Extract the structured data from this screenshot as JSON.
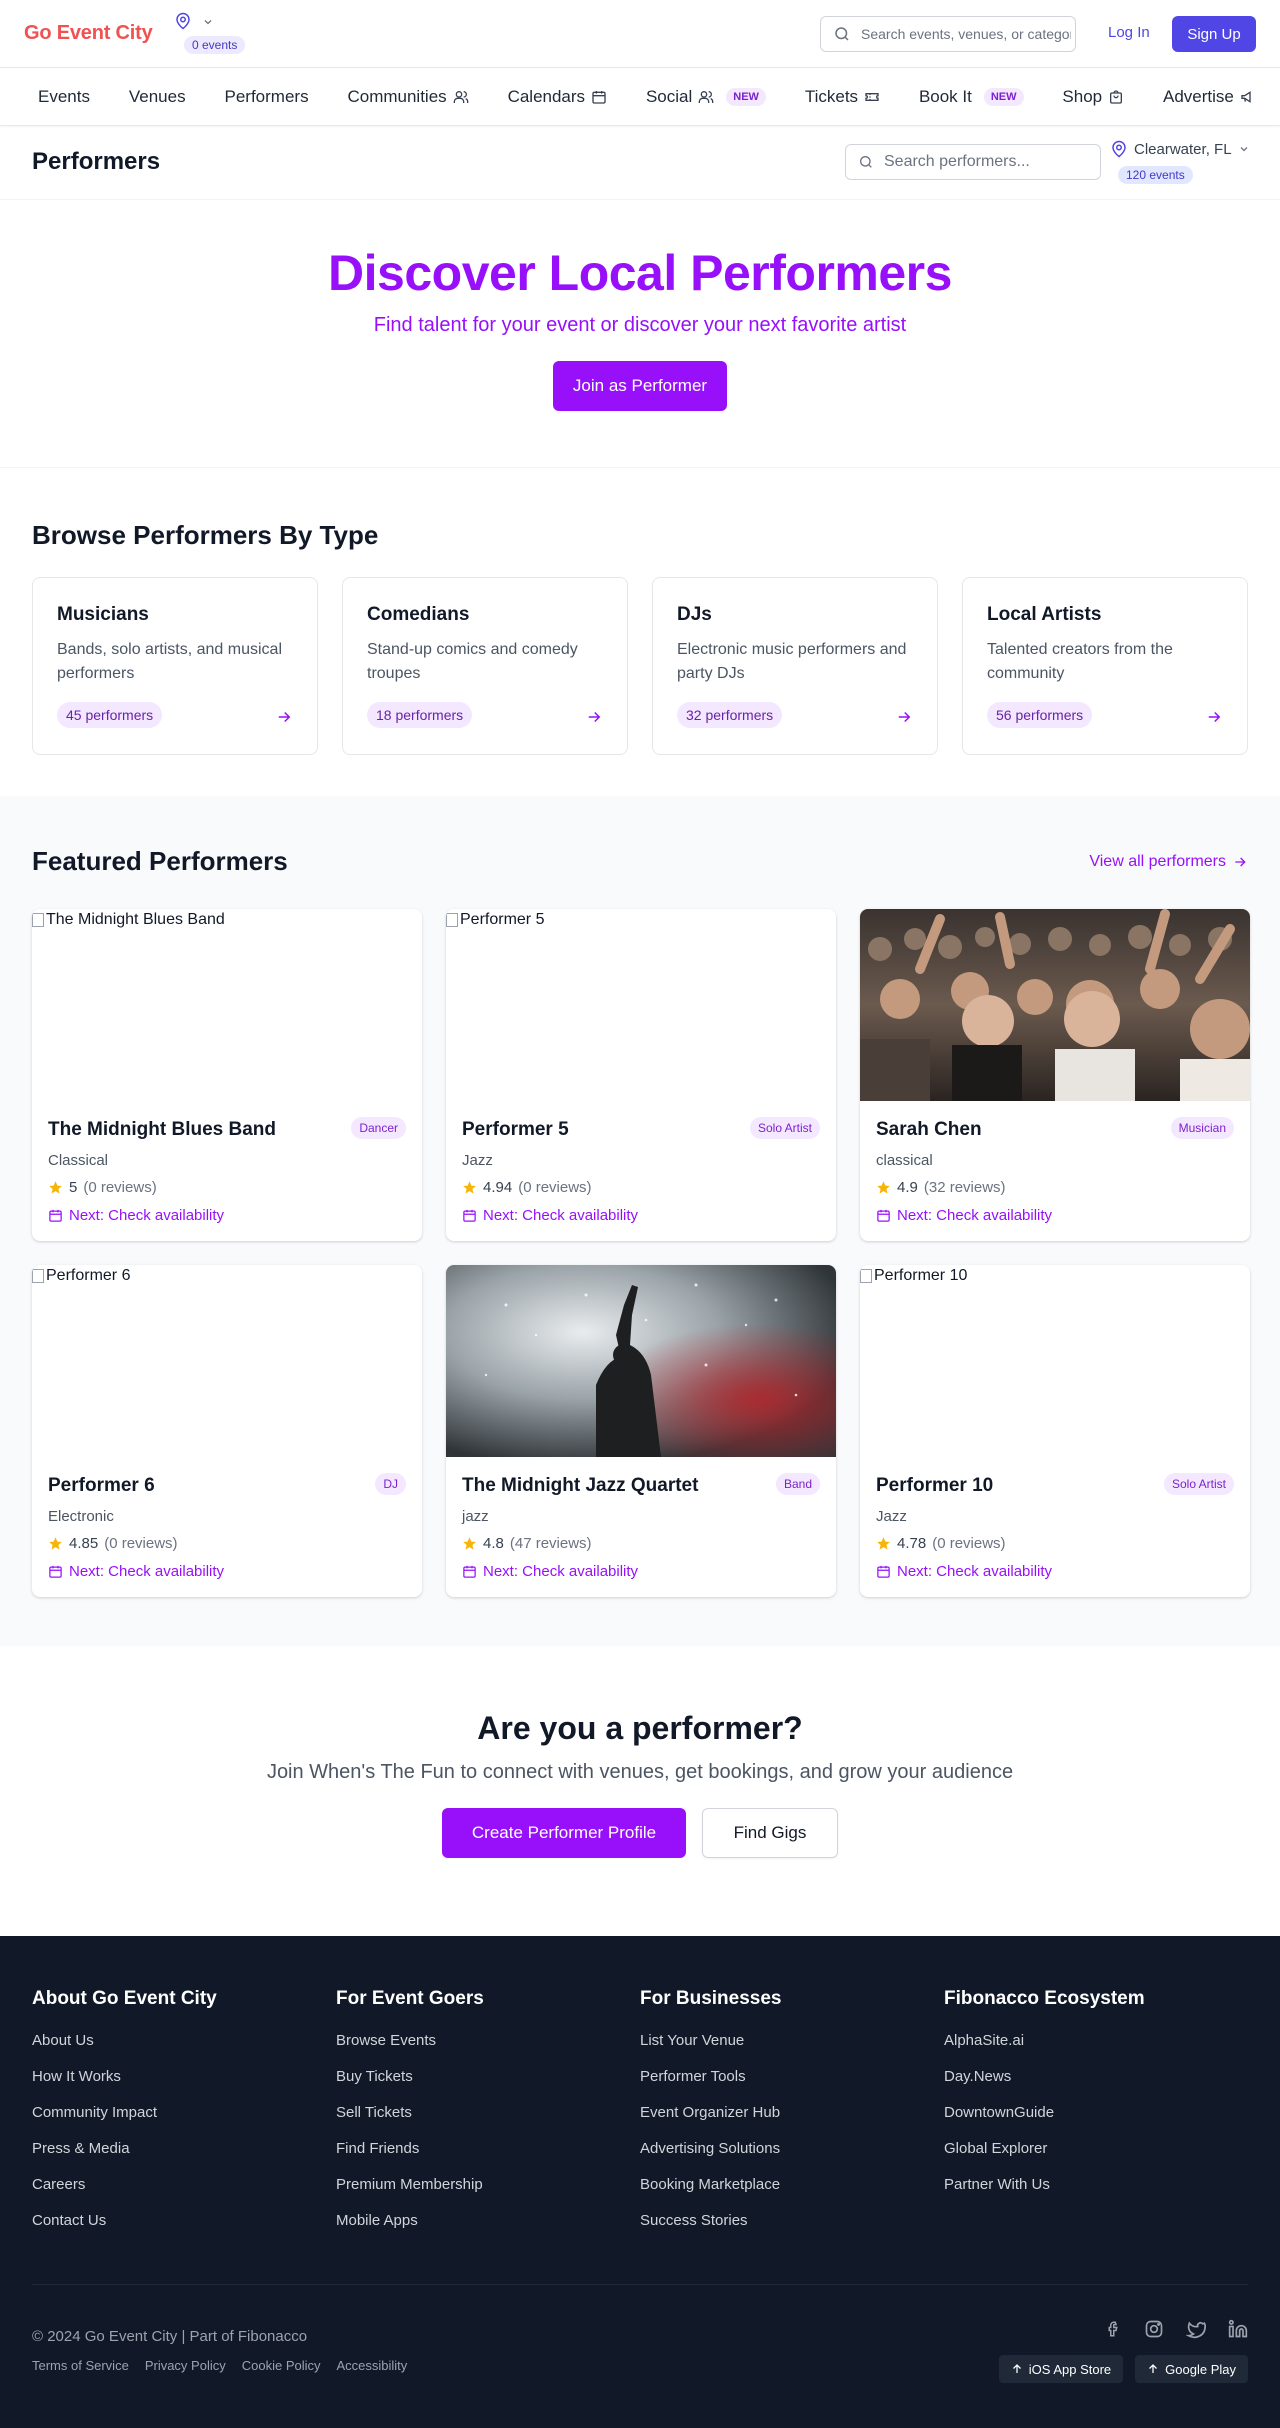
{
  "header": {
    "logo": "Go Event City",
    "location_badge": "0 events",
    "search_placeholder": "Search events, venues, or categories",
    "login": "Log In",
    "signup": "Sign Up"
  },
  "nav": {
    "items": [
      {
        "label": "Events",
        "icon": ""
      },
      {
        "label": "Venues",
        "icon": ""
      },
      {
        "label": "Performers",
        "icon": ""
      },
      {
        "label": "Communities",
        "icon": "users-icon"
      },
      {
        "label": "Calendars",
        "icon": "calendar-icon"
      },
      {
        "label": "Social",
        "icon": "users-icon",
        "badge": "NEW"
      },
      {
        "label": "Tickets",
        "icon": "ticket-icon"
      },
      {
        "label": "Book It",
        "icon": "",
        "badge": "NEW"
      },
      {
        "label": "Shop",
        "icon": "shopping-bag-icon"
      },
      {
        "label": "Advertise",
        "icon": "megaphone-icon"
      }
    ]
  },
  "page": {
    "title": "Performers",
    "search_placeholder": "Search performers...",
    "city": "Clearwater, FL",
    "city_badge": "120 events"
  },
  "hero": {
    "title": "Discover Local Performers",
    "subtitle": "Find talent for your event or discover your next favorite artist",
    "button": "Join as Performer"
  },
  "browse": {
    "title": "Browse Performers By Type",
    "types": [
      {
        "title": "Musicians",
        "description": "Bands, solo artists, and musical performers",
        "count": "45 performers"
      },
      {
        "title": "Comedians",
        "description": "Stand-up comics and comedy troupes",
        "count": "18 performers"
      },
      {
        "title": "DJs",
        "description": "Electronic music performers and party DJs",
        "count": "32 performers"
      },
      {
        "title": "Local Artists",
        "description": "Talented creators from the community",
        "count": "56 performers"
      }
    ]
  },
  "featured": {
    "title": "Featured Performers",
    "view_all": "View all performers",
    "performers": [
      {
        "name": "The Midnight Blues Band",
        "tag": "Dancer",
        "genre": "Classical",
        "rating": "5",
        "reviews": "(0 reviews)",
        "next": "Next: Check availability",
        "image_alt": "The Midnight Blues Band",
        "image": "none"
      },
      {
        "name": "Performer 5",
        "tag": "Solo Artist",
        "genre": "Jazz",
        "rating": "4.94",
        "reviews": "(0 reviews)",
        "next": "Next: Check availability",
        "image_alt": "Performer 5",
        "image": "none"
      },
      {
        "name": "Sarah Chen",
        "tag": "Musician",
        "genre": "classical",
        "rating": "4.9",
        "reviews": "(32 reviews)",
        "next": "Next: Check availability",
        "image_alt": "",
        "image": "concert-crowd-photo"
      },
      {
        "name": "Performer 6",
        "tag": "DJ",
        "genre": "Electronic",
        "rating": "4.85",
        "reviews": "(0 reviews)",
        "next": "Next: Check availability",
        "image_alt": "Performer 6",
        "image": "none"
      },
      {
        "name": "The Midnight Jazz Quartet",
        "tag": "Band",
        "genre": "jazz",
        "rating": "4.8",
        "reviews": "(47 reviews)",
        "next": "Next: Check availability",
        "image_alt": "",
        "image": "performer-on-stage-photo"
      },
      {
        "name": "Performer 10",
        "tag": "Solo Artist",
        "genre": "Jazz",
        "rating": "4.78",
        "reviews": "(0 reviews)",
        "next": "Next: Check availability",
        "image_alt": "Performer 10",
        "image": "none"
      }
    ]
  },
  "cta": {
    "title": "Are you a performer?",
    "subtitle": "Join When's The Fun to connect with venues, get bookings, and grow your audience",
    "primary": "Create Performer Profile",
    "secondary": "Find Gigs"
  },
  "footer": {
    "columns": [
      {
        "title": "About Go Event City",
        "links": [
          "About Us",
          "How It Works",
          "Community Impact",
          "Press & Media",
          "Careers",
          "Contact Us"
        ]
      },
      {
        "title": "For Event Goers",
        "links": [
          "Browse Events",
          "Buy Tickets",
          "Sell Tickets",
          "Find Friends",
          "Premium Membership",
          "Mobile Apps"
        ]
      },
      {
        "title": "For Businesses",
        "links": [
          "List Your Venue",
          "Performer Tools",
          "Event Organizer Hub",
          "Advertising Solutions",
          "Booking Marketplace",
          "Success Stories"
        ]
      },
      {
        "title": "Fibonacco Ecosystem",
        "links": [
          "AlphaSite.ai",
          "Day.News",
          "DowntownGuide",
          "Global Explorer",
          "Partner With Us"
        ]
      }
    ],
    "copyright": "© 2024 Go Event City | Part of Fibonacco",
    "legal": [
      "Terms of Service",
      "Privacy Policy",
      "Cookie Policy",
      "Accessibility"
    ],
    "social": [
      "facebook-icon",
      "instagram-icon",
      "twitter-icon",
      "linkedin-icon"
    ],
    "stores": [
      "iOS App Store",
      "Google Play"
    ]
  },
  "colors": {
    "brand_logo": "#f05252",
    "primary_purple": "#9810fa",
    "indigo_button": "#4f46e5",
    "footer_bg": "#111827",
    "star": "#f5b50a"
  }
}
